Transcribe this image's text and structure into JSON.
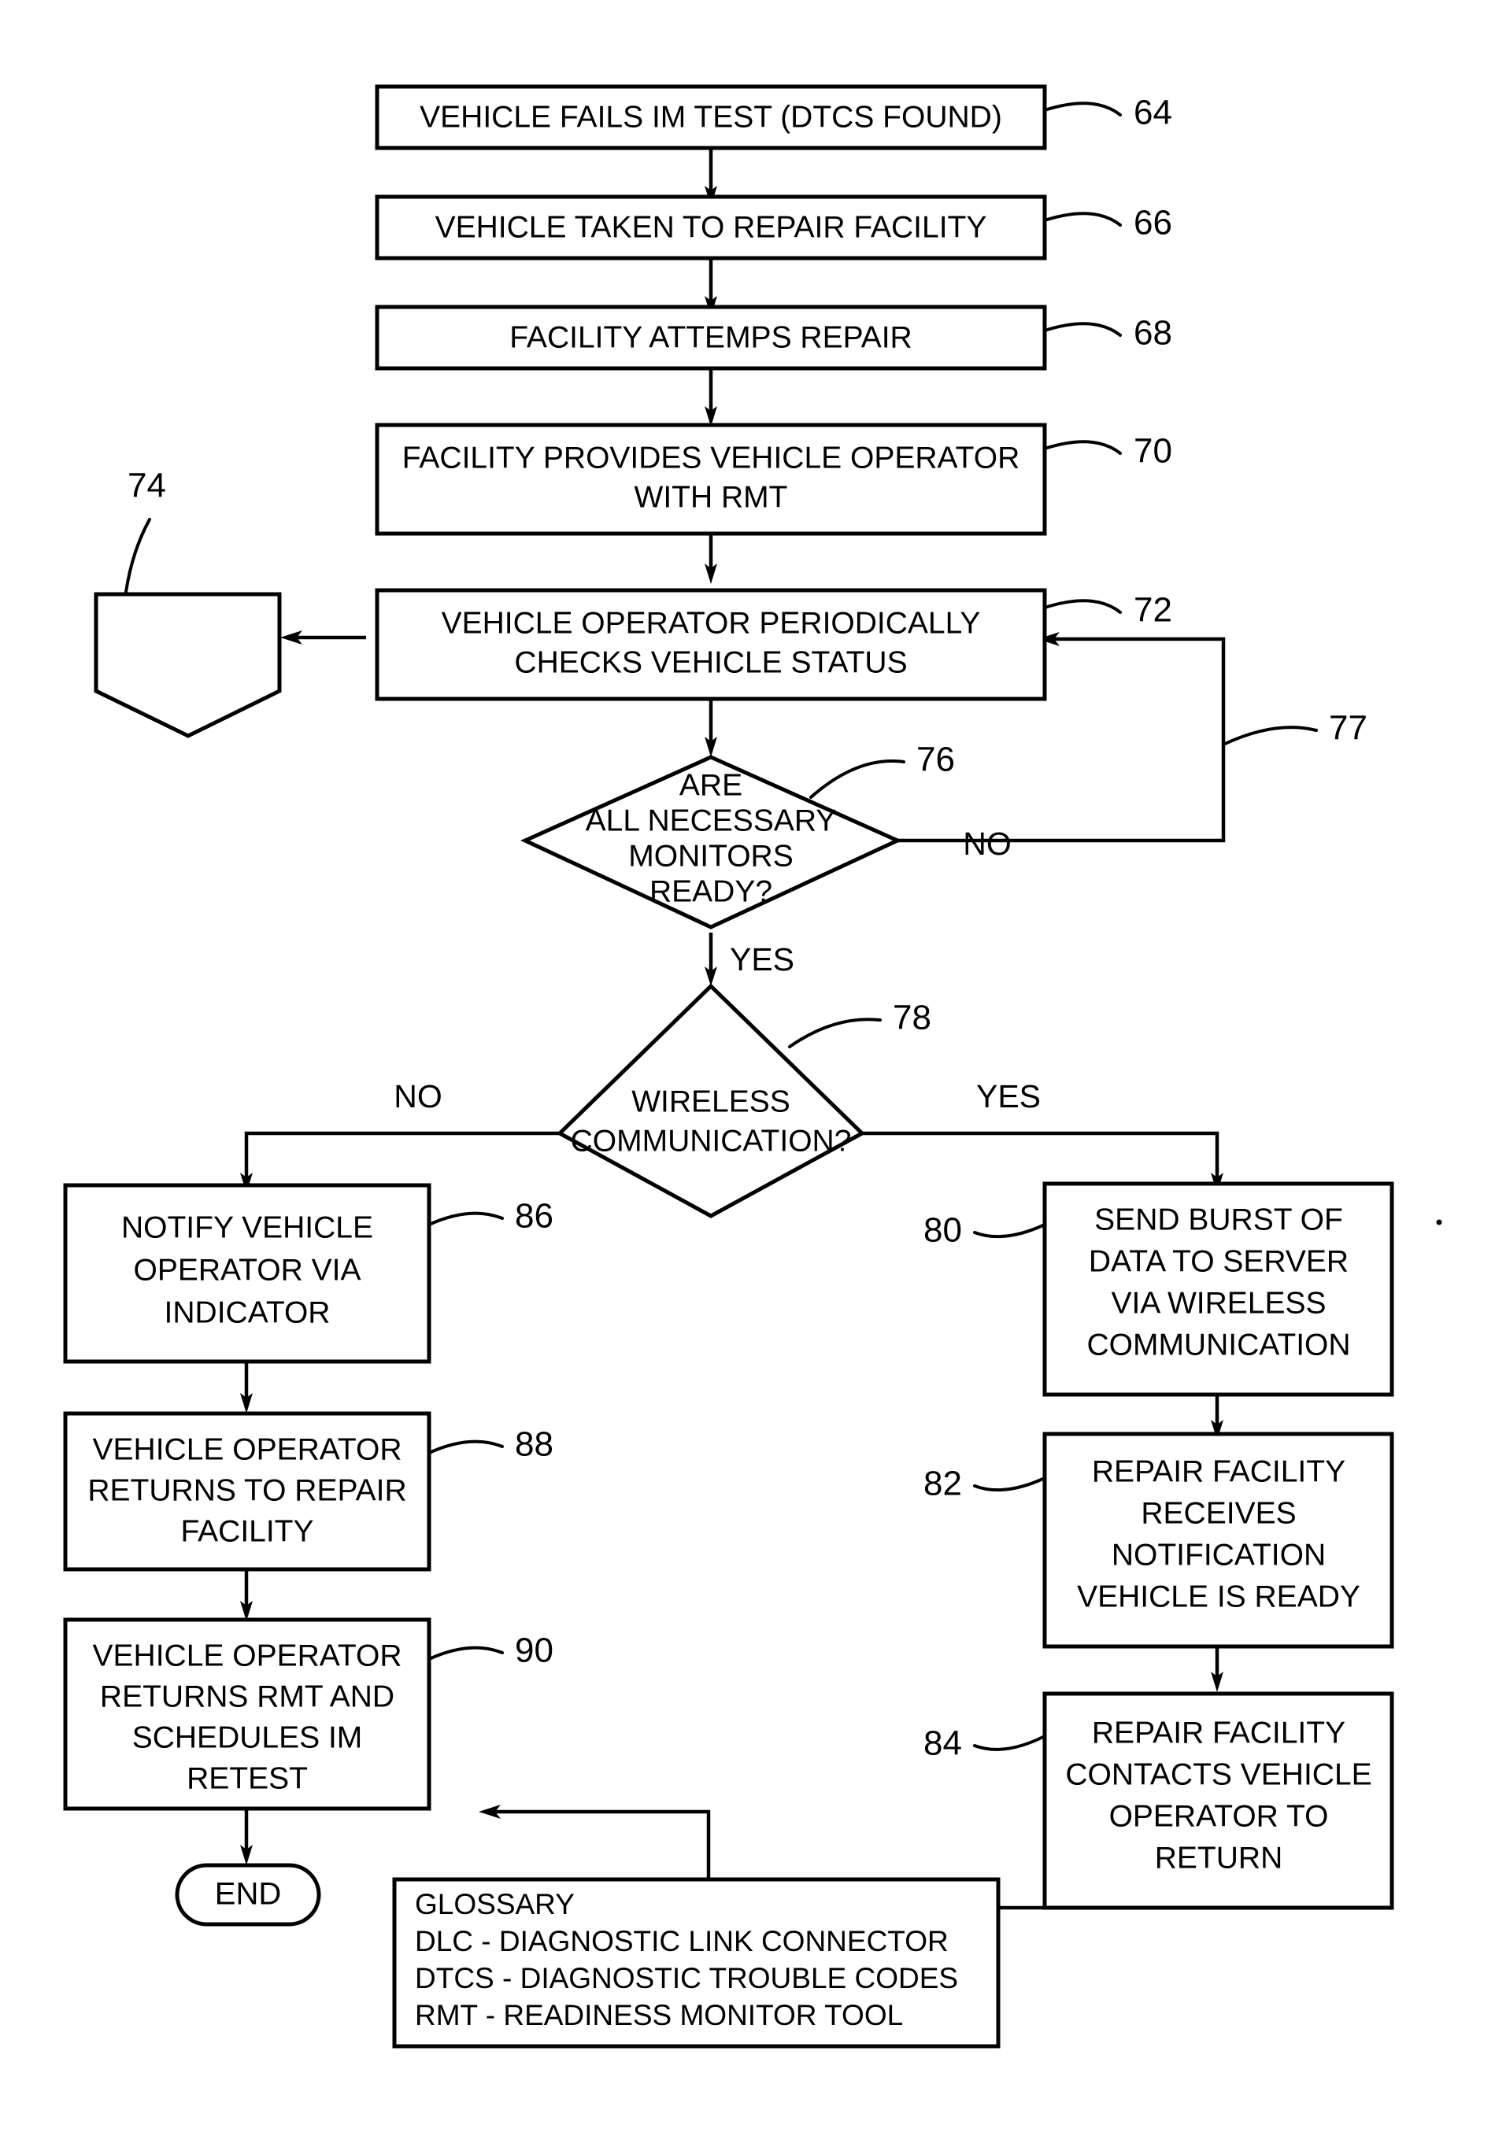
{
  "diagram": {
    "type": "flowchart",
    "title_present": false,
    "colors": {
      "stroke": "#000000",
      "fill": "#ffffff",
      "text": "#000000"
    },
    "nodes": [
      {
        "id": "64",
        "ref": "64",
        "shape": "process",
        "lines": [
          "VEHICLE FAILS IM TEST (DTCS FOUND)"
        ]
      },
      {
        "id": "66",
        "ref": "66",
        "shape": "process",
        "lines": [
          "VEHICLE TAKEN TO REPAIR FACILITY"
        ]
      },
      {
        "id": "68",
        "ref": "68",
        "shape": "process",
        "lines": [
          "FACILITY ATTEMPS REPAIR"
        ]
      },
      {
        "id": "70",
        "ref": "70",
        "shape": "process",
        "lines": [
          "FACILITY PROVIDES VEHICLE OPERATOR",
          "WITH RMT"
        ]
      },
      {
        "id": "72",
        "ref": "72",
        "shape": "process",
        "lines": [
          "VEHICLE OPERATOR PERIODICALLY",
          "CHECKS VEHICLE STATUS"
        ]
      },
      {
        "id": "74",
        "ref": "74",
        "shape": "pentagon-down",
        "lines": []
      },
      {
        "id": "76",
        "ref": "76",
        "shape": "decision",
        "lines": [
          "ARE",
          "ALL NECESSARY",
          "MONITORS",
          "READY?"
        ]
      },
      {
        "id": "78",
        "ref": "78",
        "shape": "decision",
        "lines": [
          "WIRELESS",
          "COMMUNICATION?"
        ]
      },
      {
        "id": "80",
        "ref": "80",
        "shape": "process",
        "lines": [
          "SEND BURST OF",
          "DATA TO SERVER",
          "VIA WIRELESS",
          "COMMUNICATION"
        ]
      },
      {
        "id": "82",
        "ref": "82",
        "shape": "process",
        "lines": [
          "REPAIR FACILITY",
          "RECEIVES",
          "NOTIFICATION",
          "VEHICLE IS READY"
        ]
      },
      {
        "id": "84",
        "ref": "84",
        "shape": "process",
        "lines": [
          "REPAIR FACILITY",
          "CONTACTS VEHICLE",
          "OPERATOR TO",
          "RETURN"
        ]
      },
      {
        "id": "86",
        "ref": "86",
        "shape": "process",
        "lines": [
          "NOTIFY VEHICLE",
          "OPERATOR VIA",
          "INDICATOR"
        ]
      },
      {
        "id": "88",
        "ref": "88",
        "shape": "process",
        "lines": [
          "VEHICLE OPERATOR",
          "RETURNS TO REPAIR",
          "FACILITY"
        ]
      },
      {
        "id": "90",
        "ref": "90",
        "shape": "process",
        "lines": [
          "VEHICLE OPERATOR",
          "RETURNS RMT AND",
          "SCHEDULES IM",
          "RETEST"
        ]
      },
      {
        "id": "end",
        "ref": "",
        "shape": "terminator",
        "lines": [
          "END"
        ]
      }
    ],
    "edges": [
      {
        "from": "64",
        "to": "66",
        "label": ""
      },
      {
        "from": "66",
        "to": "68",
        "label": ""
      },
      {
        "from": "68",
        "to": "70",
        "label": ""
      },
      {
        "from": "70",
        "to": "72",
        "label": ""
      },
      {
        "from": "72",
        "to": "74",
        "label": ""
      },
      {
        "from": "72",
        "to": "76",
        "label": ""
      },
      {
        "from": "76",
        "to": "77-loop",
        "label": "NO",
        "ref": "77"
      },
      {
        "from": "76",
        "to": "78",
        "label": "YES"
      },
      {
        "from": "78",
        "to": "86",
        "label": "NO"
      },
      {
        "from": "78",
        "to": "80",
        "label": "YES"
      },
      {
        "from": "80",
        "to": "82",
        "label": ""
      },
      {
        "from": "82",
        "to": "84",
        "label": ""
      },
      {
        "from": "84",
        "to": "90",
        "label": ""
      },
      {
        "from": "86",
        "to": "88",
        "label": ""
      },
      {
        "from": "88",
        "to": "90",
        "label": ""
      },
      {
        "from": "90",
        "to": "end",
        "label": ""
      }
    ],
    "refs": {
      "r64": "64",
      "r66": "66",
      "r68": "68",
      "r70": "70",
      "r72": "72",
      "r74": "74",
      "r76": "76",
      "r77": "77",
      "r78": "78",
      "r80": "80",
      "r82": "82",
      "r84": "84",
      "r86": "86",
      "r88": "88",
      "r90": "90"
    },
    "branch_labels": {
      "d76_no": "NO",
      "d76_yes": "YES",
      "d78_no": "NO",
      "d78_yes": "YES"
    },
    "node_text": {
      "n64_l1": "VEHICLE FAILS IM TEST (DTCS FOUND)",
      "n66_l1": "VEHICLE TAKEN TO REPAIR FACILITY",
      "n68_l1": "FACILITY ATTEMPS REPAIR",
      "n70_l1": "FACILITY PROVIDES VEHICLE OPERATOR",
      "n70_l2": "WITH RMT",
      "n72_l1": "VEHICLE OPERATOR PERIODICALLY",
      "n72_l2": "CHECKS VEHICLE STATUS",
      "n76_l1": "ARE",
      "n76_l2": "ALL NECESSARY",
      "n76_l3": "MONITORS",
      "n76_l4": "READY?",
      "n78_l1": "WIRELESS",
      "n78_l2": "COMMUNICATION?",
      "n80_l1": "SEND BURST OF",
      "n80_l2": "DATA TO SERVER",
      "n80_l3": "VIA WIRELESS",
      "n80_l4": "COMMUNICATION",
      "n82_l1": "REPAIR FACILITY",
      "n82_l2": "RECEIVES",
      "n82_l3": "NOTIFICATION",
      "n82_l4": "VEHICLE IS READY",
      "n84_l1": "REPAIR FACILITY",
      "n84_l2": "CONTACTS VEHICLE",
      "n84_l3": "OPERATOR TO",
      "n84_l4": "RETURN",
      "n86_l1": "NOTIFY VEHICLE",
      "n86_l2": "OPERATOR VIA",
      "n86_l3": "INDICATOR",
      "n88_l1": "VEHICLE OPERATOR",
      "n88_l2": "RETURNS TO REPAIR",
      "n88_l3": "FACILITY",
      "n90_l1": "VEHICLE OPERATOR",
      "n90_l2": "RETURNS RMT AND",
      "n90_l3": "SCHEDULES IM",
      "n90_l4": "RETEST",
      "end_label": "END"
    },
    "glossary": {
      "title": "GLOSSARY",
      "entries": [
        "DLC - DIAGNOSTIC LINK CONNECTOR",
        "DTCS - DIAGNOSTIC TROUBLE CODES",
        "RMT - READINESS MONITOR TOOL"
      ],
      "line1": "GLOSSARY",
      "line2": "DLC - DIAGNOSTIC LINK CONNECTOR",
      "line3": "DTCS - DIAGNOSTIC TROUBLE CODES",
      "line4": "RMT - READINESS MONITOR TOOL"
    }
  }
}
